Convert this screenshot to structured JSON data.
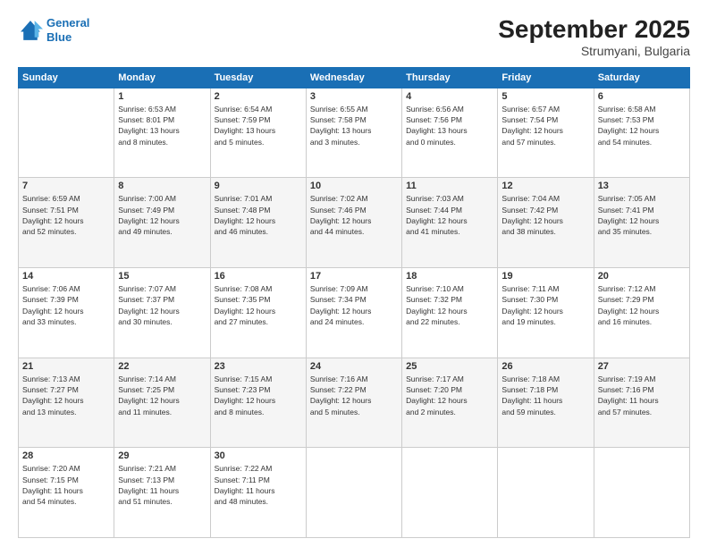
{
  "header": {
    "logo_line1": "General",
    "logo_line2": "Blue",
    "month_year": "September 2025",
    "location": "Strumyani, Bulgaria"
  },
  "weekdays": [
    "Sunday",
    "Monday",
    "Tuesday",
    "Wednesday",
    "Thursday",
    "Friday",
    "Saturday"
  ],
  "weeks": [
    [
      {
        "day": "",
        "info": ""
      },
      {
        "day": "1",
        "info": "Sunrise: 6:53 AM\nSunset: 8:01 PM\nDaylight: 13 hours\nand 8 minutes."
      },
      {
        "day": "2",
        "info": "Sunrise: 6:54 AM\nSunset: 7:59 PM\nDaylight: 13 hours\nand 5 minutes."
      },
      {
        "day": "3",
        "info": "Sunrise: 6:55 AM\nSunset: 7:58 PM\nDaylight: 13 hours\nand 3 minutes."
      },
      {
        "day": "4",
        "info": "Sunrise: 6:56 AM\nSunset: 7:56 PM\nDaylight: 13 hours\nand 0 minutes."
      },
      {
        "day": "5",
        "info": "Sunrise: 6:57 AM\nSunset: 7:54 PM\nDaylight: 12 hours\nand 57 minutes."
      },
      {
        "day": "6",
        "info": "Sunrise: 6:58 AM\nSunset: 7:53 PM\nDaylight: 12 hours\nand 54 minutes."
      }
    ],
    [
      {
        "day": "7",
        "info": "Sunrise: 6:59 AM\nSunset: 7:51 PM\nDaylight: 12 hours\nand 52 minutes."
      },
      {
        "day": "8",
        "info": "Sunrise: 7:00 AM\nSunset: 7:49 PM\nDaylight: 12 hours\nand 49 minutes."
      },
      {
        "day": "9",
        "info": "Sunrise: 7:01 AM\nSunset: 7:48 PM\nDaylight: 12 hours\nand 46 minutes."
      },
      {
        "day": "10",
        "info": "Sunrise: 7:02 AM\nSunset: 7:46 PM\nDaylight: 12 hours\nand 44 minutes."
      },
      {
        "day": "11",
        "info": "Sunrise: 7:03 AM\nSunset: 7:44 PM\nDaylight: 12 hours\nand 41 minutes."
      },
      {
        "day": "12",
        "info": "Sunrise: 7:04 AM\nSunset: 7:42 PM\nDaylight: 12 hours\nand 38 minutes."
      },
      {
        "day": "13",
        "info": "Sunrise: 7:05 AM\nSunset: 7:41 PM\nDaylight: 12 hours\nand 35 minutes."
      }
    ],
    [
      {
        "day": "14",
        "info": "Sunrise: 7:06 AM\nSunset: 7:39 PM\nDaylight: 12 hours\nand 33 minutes."
      },
      {
        "day": "15",
        "info": "Sunrise: 7:07 AM\nSunset: 7:37 PM\nDaylight: 12 hours\nand 30 minutes."
      },
      {
        "day": "16",
        "info": "Sunrise: 7:08 AM\nSunset: 7:35 PM\nDaylight: 12 hours\nand 27 minutes."
      },
      {
        "day": "17",
        "info": "Sunrise: 7:09 AM\nSunset: 7:34 PM\nDaylight: 12 hours\nand 24 minutes."
      },
      {
        "day": "18",
        "info": "Sunrise: 7:10 AM\nSunset: 7:32 PM\nDaylight: 12 hours\nand 22 minutes."
      },
      {
        "day": "19",
        "info": "Sunrise: 7:11 AM\nSunset: 7:30 PM\nDaylight: 12 hours\nand 19 minutes."
      },
      {
        "day": "20",
        "info": "Sunrise: 7:12 AM\nSunset: 7:29 PM\nDaylight: 12 hours\nand 16 minutes."
      }
    ],
    [
      {
        "day": "21",
        "info": "Sunrise: 7:13 AM\nSunset: 7:27 PM\nDaylight: 12 hours\nand 13 minutes."
      },
      {
        "day": "22",
        "info": "Sunrise: 7:14 AM\nSunset: 7:25 PM\nDaylight: 12 hours\nand 11 minutes."
      },
      {
        "day": "23",
        "info": "Sunrise: 7:15 AM\nSunset: 7:23 PM\nDaylight: 12 hours\nand 8 minutes."
      },
      {
        "day": "24",
        "info": "Sunrise: 7:16 AM\nSunset: 7:22 PM\nDaylight: 12 hours\nand 5 minutes."
      },
      {
        "day": "25",
        "info": "Sunrise: 7:17 AM\nSunset: 7:20 PM\nDaylight: 12 hours\nand 2 minutes."
      },
      {
        "day": "26",
        "info": "Sunrise: 7:18 AM\nSunset: 7:18 PM\nDaylight: 11 hours\nand 59 minutes."
      },
      {
        "day": "27",
        "info": "Sunrise: 7:19 AM\nSunset: 7:16 PM\nDaylight: 11 hours\nand 57 minutes."
      }
    ],
    [
      {
        "day": "28",
        "info": "Sunrise: 7:20 AM\nSunset: 7:15 PM\nDaylight: 11 hours\nand 54 minutes."
      },
      {
        "day": "29",
        "info": "Sunrise: 7:21 AM\nSunset: 7:13 PM\nDaylight: 11 hours\nand 51 minutes."
      },
      {
        "day": "30",
        "info": "Sunrise: 7:22 AM\nSunset: 7:11 PM\nDaylight: 11 hours\nand 48 minutes."
      },
      {
        "day": "",
        "info": ""
      },
      {
        "day": "",
        "info": ""
      },
      {
        "day": "",
        "info": ""
      },
      {
        "day": "",
        "info": ""
      }
    ]
  ]
}
